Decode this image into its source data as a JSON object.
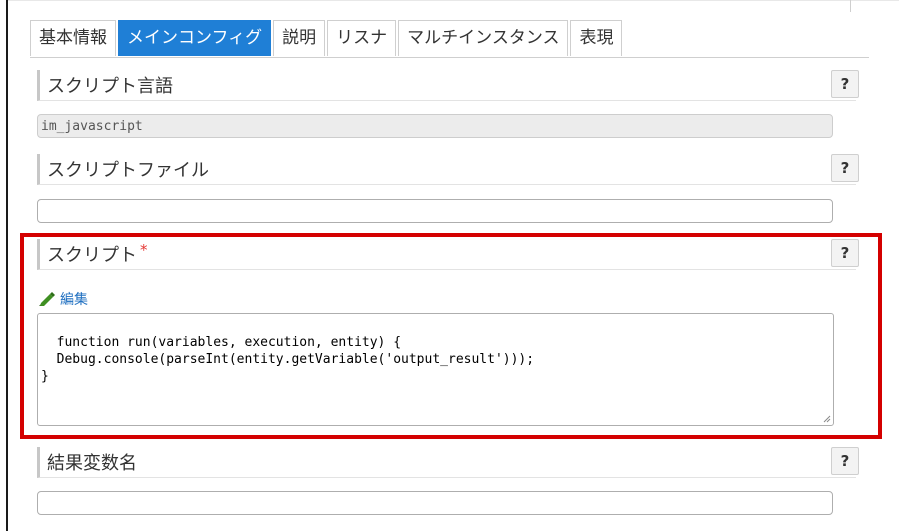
{
  "tabs": [
    {
      "label": "基本情報",
      "active": false
    },
    {
      "label": "メインコンフィグ",
      "active": true
    },
    {
      "label": "説明",
      "active": false
    },
    {
      "label": "リスナ",
      "active": false
    },
    {
      "label": "マルチインスタンス",
      "active": false
    },
    {
      "label": "表現",
      "active": false
    }
  ],
  "script_language": {
    "label": "スクリプト言語",
    "value": "im_javascript",
    "help": "?"
  },
  "script_file": {
    "label": "スクリプトファイル",
    "value": "",
    "help": "?"
  },
  "script": {
    "label": "スクリプト",
    "required_mark": "*",
    "help": "?",
    "edit_label": "編集",
    "code": "function run(variables, execution, entity) {\n  Debug.console(parseInt(entity.getVariable('output_result')));\n}"
  },
  "result_variable": {
    "label": "結果変数名",
    "value": "",
    "help": "?"
  },
  "icons": {
    "edit": "pencil-icon",
    "grip": "resize-grip-icon"
  },
  "colors": {
    "active_tab": "#1f7fd6",
    "highlight": "#d40000",
    "link": "#1f6fc0",
    "required": "#e53935"
  }
}
